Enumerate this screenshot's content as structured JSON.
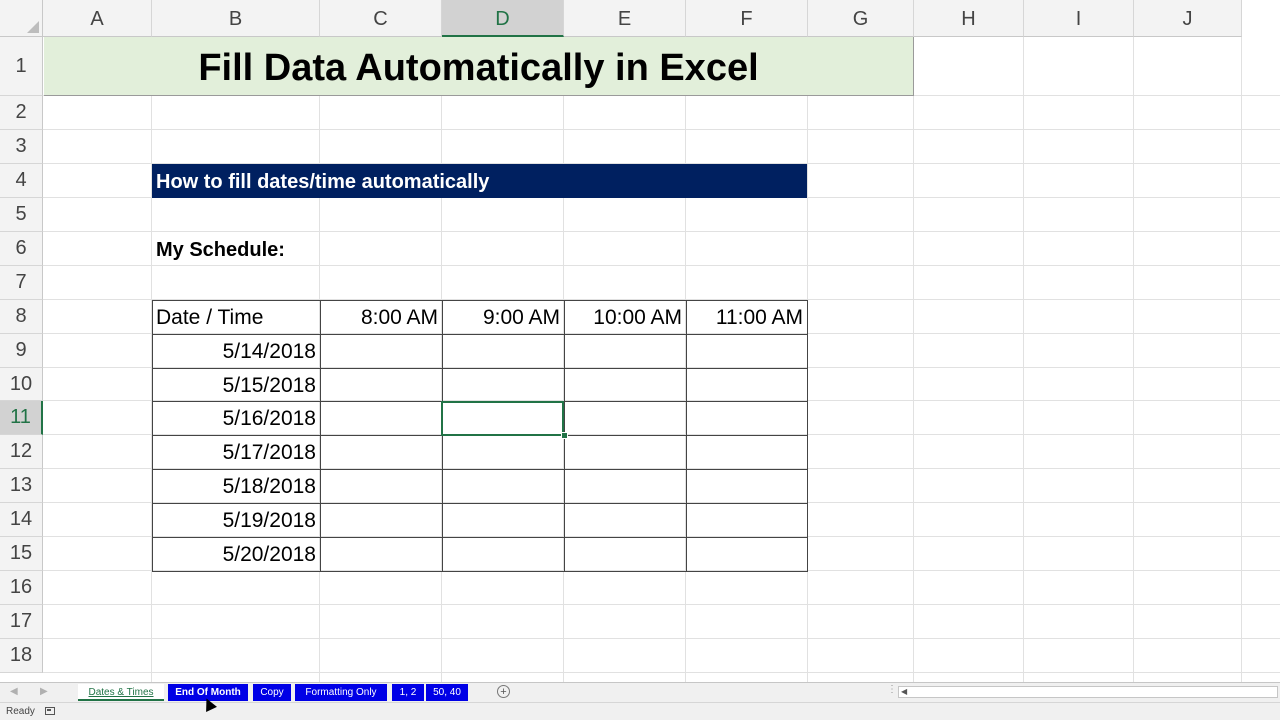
{
  "columns": [
    "A",
    "B",
    "C",
    "D",
    "E",
    "F",
    "G",
    "H",
    "I",
    "J"
  ],
  "selected_column": "D",
  "rows": [
    "1",
    "2",
    "3",
    "4",
    "5",
    "6",
    "7",
    "8",
    "9",
    "10",
    "11",
    "12",
    "13",
    "14",
    "15",
    "16",
    "17",
    "18"
  ],
  "selected_row": "11",
  "cells": {
    "title": "Fill Data Automatically in Excel",
    "banner": "How to fill dates/time automatically",
    "schedule_label": "My Schedule:",
    "table_header": "Date / Time",
    "times": [
      "8:00 AM",
      "9:00 AM",
      "10:00 AM",
      "11:00 AM"
    ],
    "dates": [
      "5/14/2018",
      "5/15/2018",
      "5/16/2018",
      "5/17/2018",
      "5/18/2018",
      "5/19/2018",
      "5/20/2018"
    ]
  },
  "sheet_tabs": [
    {
      "label": "Dates & Times",
      "active": true
    },
    {
      "label": "End Of Month",
      "active": false
    },
    {
      "label": "Copy",
      "active": false
    },
    {
      "label": "Formatting Only",
      "active": false
    },
    {
      "label": "1, 2",
      "active": false
    },
    {
      "label": "50, 40",
      "active": false
    }
  ],
  "add_sheet_icon": "plus-circle-icon",
  "status": {
    "text": "Ready"
  },
  "colors": {
    "accent": "#217346",
    "title_fill": "#e2efda",
    "banner_fill": "#002060",
    "tab_fill": "#0000e6"
  }
}
